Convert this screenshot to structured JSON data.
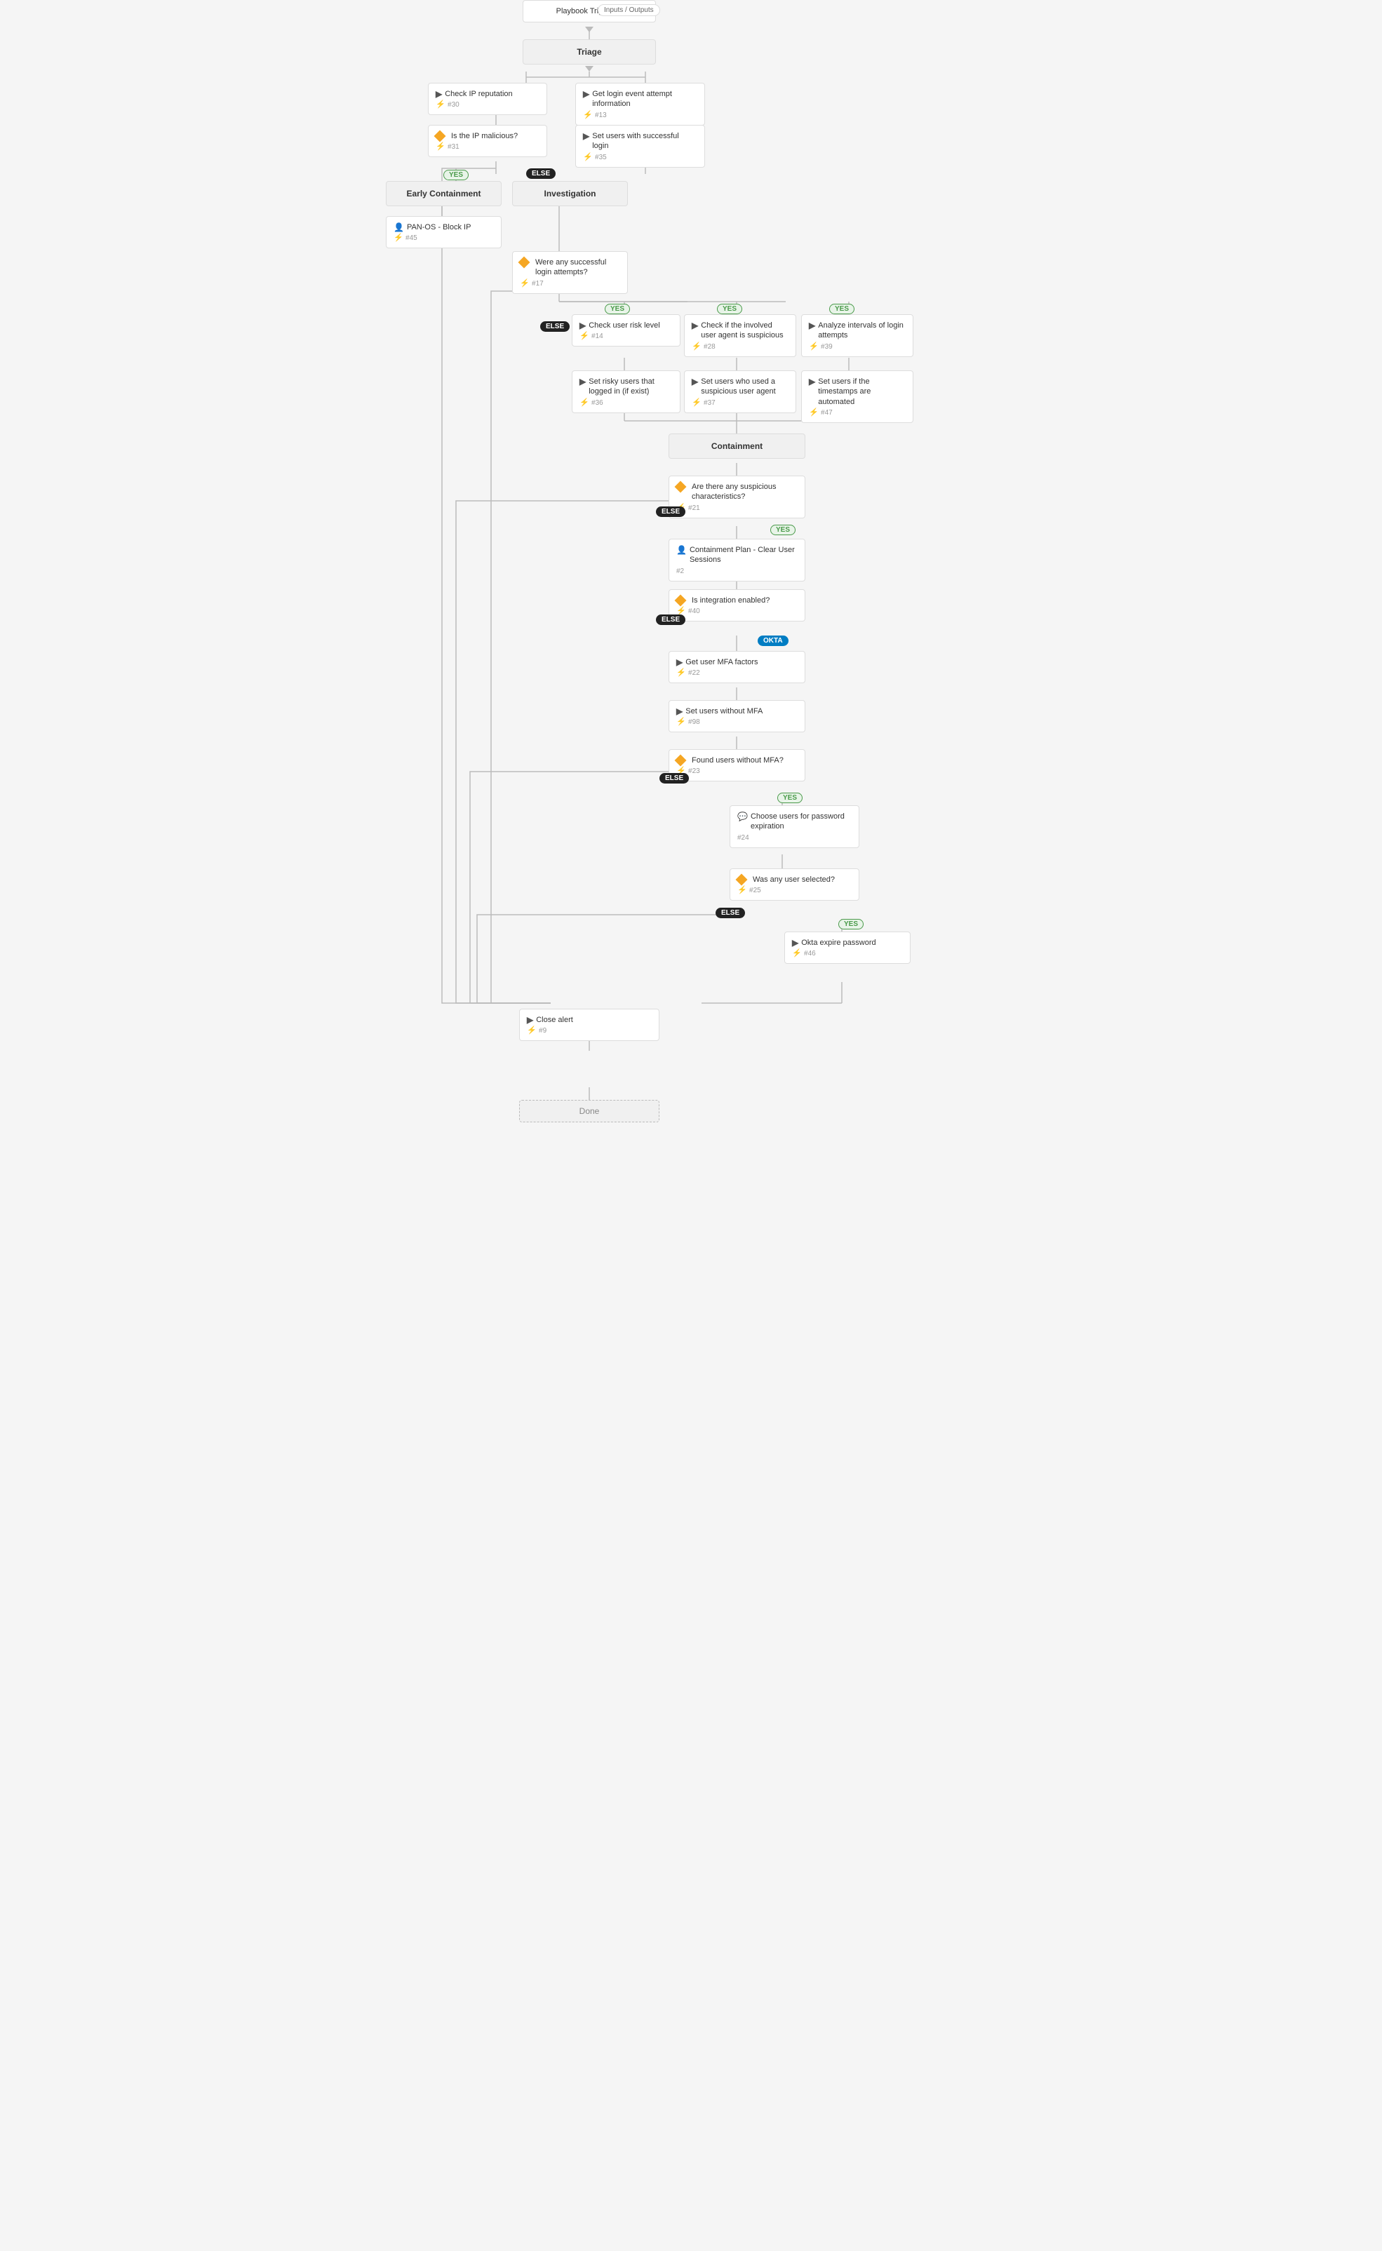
{
  "nodes": {
    "playbook_triggered": {
      "label": "Playbook Triggered",
      "id": null
    },
    "inputs_outputs": {
      "label": "Inputs / Outputs"
    },
    "triage": {
      "label": "Triage"
    },
    "check_ip": {
      "label": "Check IP reputation",
      "id": "#30"
    },
    "get_login": {
      "label": "Get login event attempt information",
      "id": "#13"
    },
    "is_ip_malicious": {
      "label": "Is the IP malicious?",
      "id": "#31"
    },
    "set_users_successful": {
      "label": "Set users with successful login",
      "id": "#35"
    },
    "early_containment": {
      "label": "Early Containment"
    },
    "investigation": {
      "label": "Investigation"
    },
    "panos_block": {
      "label": "PAN-OS - Block IP",
      "id": "#45"
    },
    "were_any_successful": {
      "label": "Were any successful login attempts?",
      "id": "#17"
    },
    "check_user_risk": {
      "label": "Check user risk level",
      "id": "#14"
    },
    "check_user_agent": {
      "label": "Check if the involved user agent is suspicious",
      "id": "#28"
    },
    "analyze_intervals": {
      "label": "Analyze intervals of login attempts",
      "id": "#39"
    },
    "set_risky_users": {
      "label": "Set risky users that logged in (if exist)",
      "id": "#36"
    },
    "set_suspicious_agent": {
      "label": "Set users who used a suspicious user agent",
      "id": "#37"
    },
    "set_timestamps": {
      "label": "Set users if the timestamps are automated",
      "id": "#47"
    },
    "containment": {
      "label": "Containment"
    },
    "are_there_suspicious": {
      "label": "Are there any suspicious characteristics?",
      "id": "#21"
    },
    "containment_plan": {
      "label": "Containment Plan - Clear User Sessions",
      "id": "#2"
    },
    "is_integration_enabled": {
      "label": "Is integration enabled?",
      "id": "#40"
    },
    "get_user_mfa": {
      "label": "Get user MFA factors",
      "id": "#22"
    },
    "set_users_without_mfa": {
      "label": "Set users without MFA",
      "id": "#98"
    },
    "found_users_without_mfa": {
      "label": "Found users without MFA?",
      "id": "#23"
    },
    "choose_users_password": {
      "label": "Choose users for password expiration",
      "id": "#24"
    },
    "was_any_user_selected": {
      "label": "Was any user selected?",
      "id": "#25"
    },
    "okta_expire_password": {
      "label": "Okta expire password",
      "id": "#46"
    },
    "close_alert": {
      "label": "Close alert",
      "id": "#9"
    },
    "done": {
      "label": "Done"
    }
  },
  "labels": {
    "yes": "YES",
    "else": "ELSE",
    "okta": "OKTA"
  },
  "colors": {
    "yes_bg": "#e8f4e8",
    "yes_text": "#4a9a4a",
    "else_bg": "#222",
    "okta_bg": "#007dc3",
    "line": "#bbb",
    "node_bg": "#ffffff",
    "section_bg": "#f0f0f0"
  }
}
